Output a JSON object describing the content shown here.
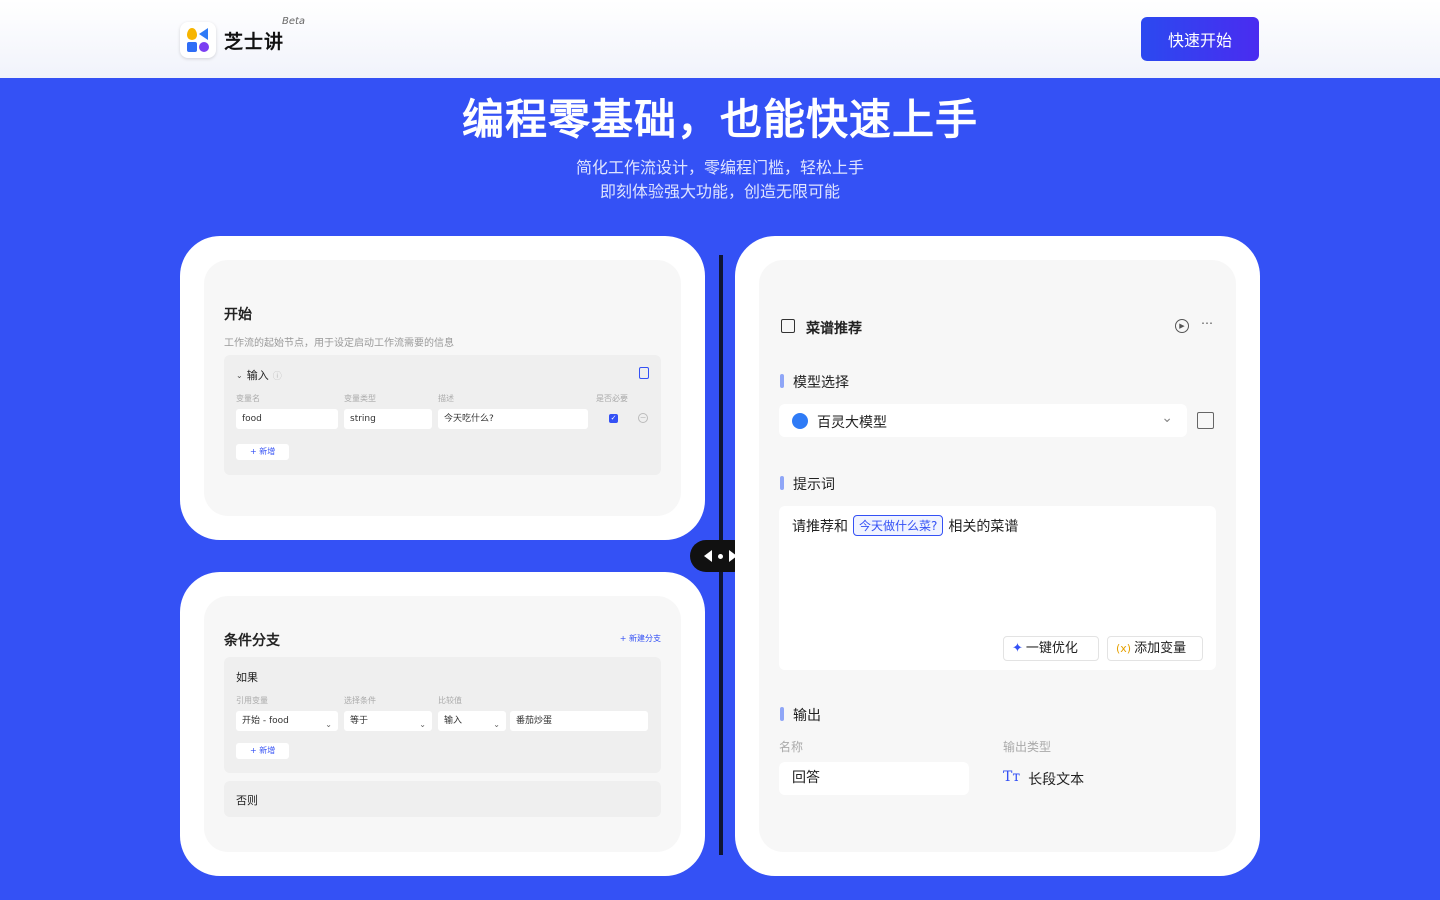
{
  "header": {
    "logo_text": "芝士讲",
    "beta": "Beta",
    "cta_label": "快速开始"
  },
  "hero": {
    "title": "编程零基础，也能快速上手",
    "sub1": "简化工作流设计，零编程门槛，轻松上手",
    "sub2": "即刻体验强大功能，创造无限可能"
  },
  "start_card": {
    "title": "开始",
    "desc": "工作流的起始节点，用于设定启动工作流需要的信息",
    "input_label": "输入",
    "col_name": "变量名",
    "col_type": "变量类型",
    "col_desc": "描述",
    "col_required": "是否必要",
    "var_name": "food",
    "var_type": "string",
    "var_desc": "今天吃什么?",
    "add_label": "+ 新增"
  },
  "branch_card": {
    "title": "条件分支",
    "new_branch": "+ 新建分支",
    "if_label": "如果",
    "col_ref": "引用变量",
    "col_cond": "选择条件",
    "col_cmp": "比较值",
    "ref_value": "开始 - food",
    "cond_value": "等于",
    "cmp_type": "输入",
    "cmp_value": "番茄炒蛋",
    "add_label": "+ 新增",
    "else_label": "否则"
  },
  "recipe_card": {
    "title": "菜谱推荐",
    "model_section": "模型选择",
    "model_name": "百灵大模型",
    "prompt_section": "提示词",
    "prompt_prefix": "请推荐和",
    "prompt_var": "今天做什么菜?",
    "prompt_suffix": "相关的菜谱",
    "optimize_label": "一键优化",
    "add_var_label": "添加变量",
    "output_section": "输出",
    "col_name": "名称",
    "col_type": "输出类型",
    "output_name": "回答",
    "output_type": "长段文本"
  },
  "colors": {
    "background": "#3451f5",
    "accent": "#3451f5",
    "cta": "#2b49f0"
  }
}
